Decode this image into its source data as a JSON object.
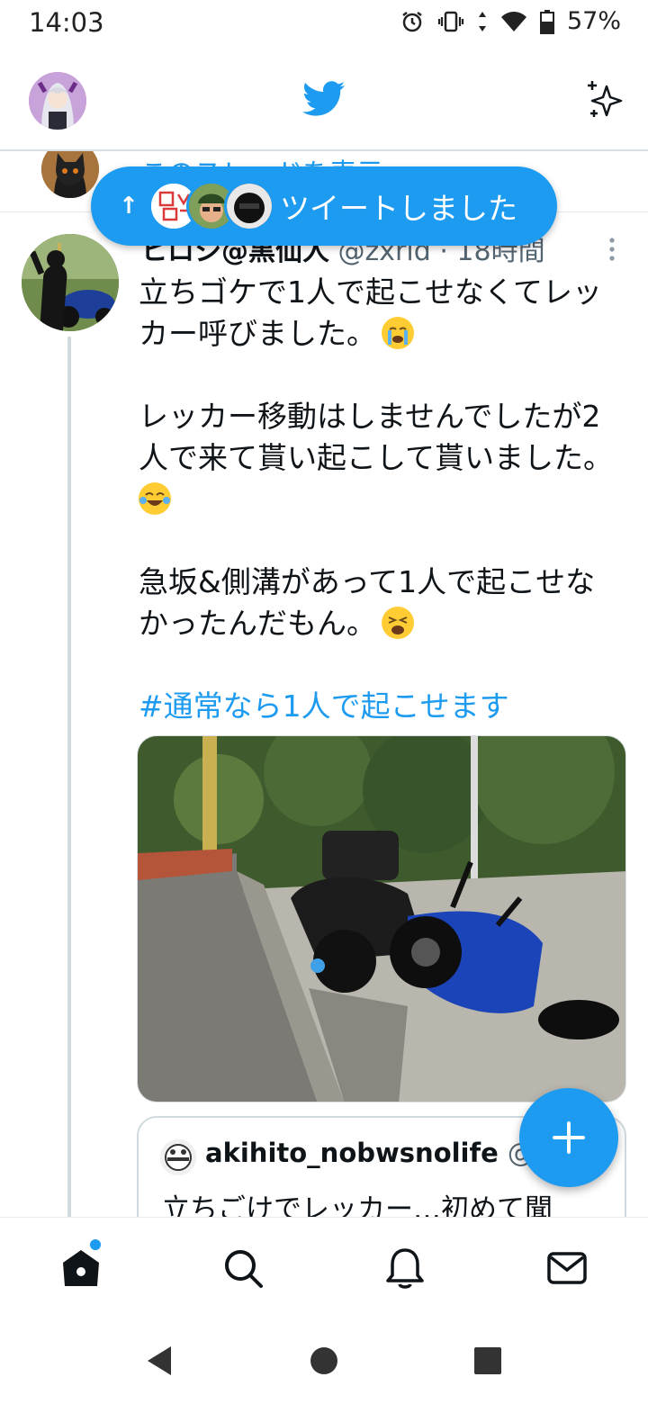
{
  "status_bar": {
    "time": "14:03",
    "battery": "57%",
    "icons": [
      "alarm-icon",
      "vibrate-icon",
      "data-arrows-icon",
      "wifi-icon",
      "battery-icon"
    ]
  },
  "header": {
    "logo_icon": "twitter-bird-icon",
    "sparkle_icon": "sparkle-icon"
  },
  "prev_thread": {
    "link_text": "このスレッドを表示"
  },
  "new_tweets_pill": {
    "arrow": "↑",
    "label": "ツイートしました"
  },
  "tweet": {
    "name": "ヒロシ@黒仙人",
    "handle": "@zxrid",
    "separator": "·",
    "time": "18時間",
    "lines": [
      "立ちゴケで1人で起こせなくてレッ",
      "カー呼びました。",
      "レッカー移動はしませんでしたが2",
      "人で来て貰い起こして貰いました。",
      "急坂&側溝があって1人で起こせな",
      "かったんだもん。"
    ],
    "hashtag": "#通常なら1人で起こせます"
  },
  "quote": {
    "name": "akihito_nobwsnolife",
    "handle": "@...",
    "text": "立ちごけでレッカー…初めて聞"
  },
  "bottom_nav": {
    "items": [
      "home-icon",
      "search-icon",
      "notifications-icon",
      "messages-icon"
    ]
  },
  "colors": {
    "accent": "#1d9bf0",
    "text": "#0f1419",
    "muted": "#536471"
  }
}
